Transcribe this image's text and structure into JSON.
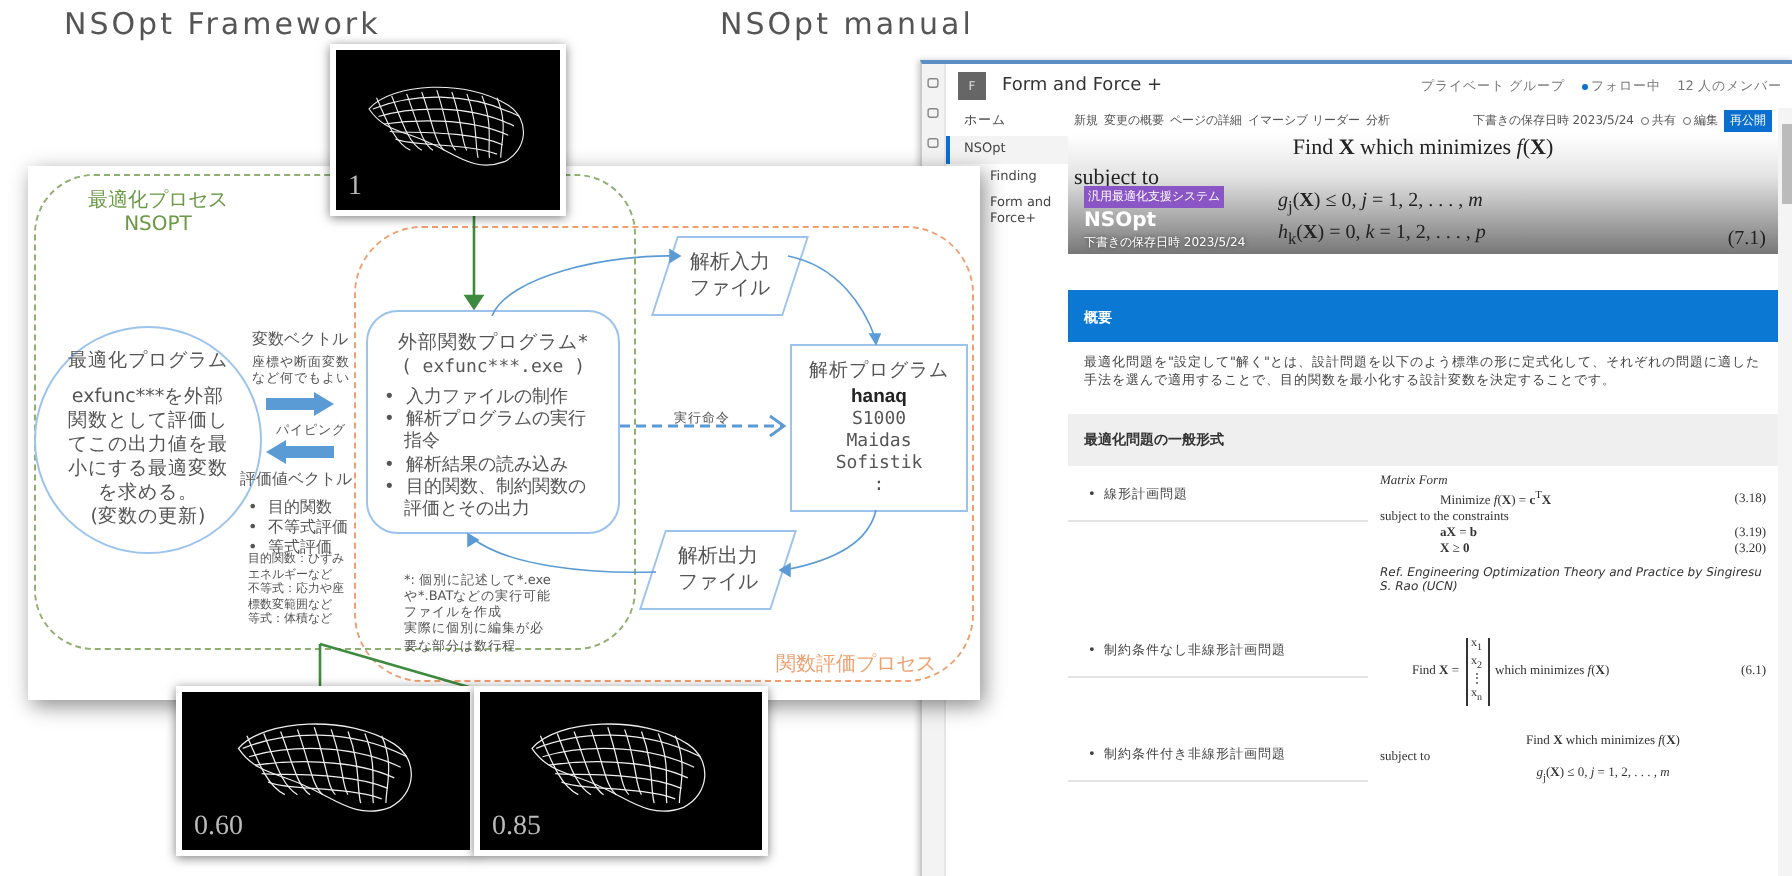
{
  "titles": [
    "NSOpt Framework",
    "NSOpt manual"
  ],
  "diagram": {
    "optimization_process": {
      "title": "最適化プロセス",
      "subtitle": "NSOPT"
    },
    "optimizer": {
      "title": "最適化プログラム",
      "text": "exfunc***を外部関数として評価してこの出力値を最小にする最適変数を求める。",
      "note": "(変数の更新)"
    },
    "variables": {
      "label": "変数ベクトル",
      "note": "座標や断面変数など何でもよい"
    },
    "piping": "パイピング",
    "evaluation": {
      "label": "評価値ベクトル",
      "items": [
        "•  目的関数",
        "•  不等式評価",
        "•  等式評価"
      ],
      "notes": [
        "目的関数：ひずみエネルギーなど",
        "不等式：応力や座標数変範囲など",
        "等式：体積など"
      ]
    },
    "function_process": "関数評価プロセス",
    "external_program": {
      "title": "外部関数プログラム*",
      "subtitle": "( exfunc***.exe )",
      "items": [
        "•  入力ファイルの制作",
        "•  解析プログラムの実行指令",
        "•  解析結果の読み込み",
        "•  目的関数、制約関数の評価とその出力"
      ],
      "notes": [
        "*: 個別に記述して*.exeや*.BATなどの実行可能ファイルを作成",
        "実際に個別に編集が必要な部分は数行程"
      ]
    },
    "input_file": [
      "解析入力",
      "ファイル"
    ],
    "output_file": [
      "解析出力",
      "ファイル"
    ],
    "analysis": {
      "title": "解析プログラム",
      "tools": [
        "hanaq",
        "S1000",
        "Maidas",
        "Sofistik",
        ":"
      ]
    },
    "command": "実行命令",
    "renders": [
      {
        "label": "1"
      },
      {
        "label": "0.60"
      },
      {
        "label": "0.85"
      }
    ]
  },
  "manual": {
    "site_logo": "F",
    "site_title": "Form and Force +",
    "group": "プライベート グループ",
    "follow": "フォロー中",
    "members": "12 人のメンバー",
    "nav": [
      {
        "label": "ホーム",
        "selected": false
      },
      {
        "label": "NSOpt",
        "selected": true
      },
      {
        "label": "Finding",
        "selected": false
      },
      {
        "label": "Form and Force+",
        "selected": false
      }
    ],
    "toolbar": [
      "新規",
      "変更の概要",
      "ページの詳細",
      "イマーシブ リーダー",
      "分析"
    ],
    "draft": "下書きの保存日時 2023/5/24",
    "share": "共有",
    "edit": "編集",
    "republish": "再公開",
    "banner": {
      "tag": "汎用最適化支援システム",
      "title": "NSOpt",
      "date": "下書きの保存日時 2023/5/24"
    },
    "equation": {
      "line": "Find **X** which minimizes *f*(**X**)",
      "subject": "subject to",
      "constraints": [
        "*g*$_{j}$(**X**) ≤ 0,    *j* = 1, 2, . . . , *m*",
        "*h*$_{k}$(**X**) = 0,    *k* = 1, 2, . . . , *p*"
      ],
      "number": "(7.1)"
    },
    "overview_heading": "概要",
    "overview_text": "最適化問題を\"設定して\"解く\"とは、設計問題を以下のよう標準の形に定式化して、それぞれの問題に適した手法を選んで適用することで、目的関数を最小化する設計変数を決定することです。",
    "general_heading": "最適化問題の一般形式",
    "rows": [
      {
        "label": "•  線形計画問題",
        "formulas": [
          {
            "kind": "caption",
            "text": "Matrix Form"
          },
          {
            "kind": "eq",
            "text": "Minimize *f*(**X**) = **c**$^{T}$**X**",
            "number": "(3.18)"
          },
          {
            "kind": "plain",
            "text": "subject to the constraints"
          },
          {
            "kind": "eq",
            "text": "**aX** = **b**",
            "number": "(3.19)"
          },
          {
            "kind": "eq",
            "text": "**X** ≥ **0**",
            "number": "(3.20)"
          },
          {
            "kind": "ref",
            "text": "Ref. Engineering Optimization Theory and Practice by Singiresu S. Rao (UCN)"
          }
        ]
      },
      {
        "label": "•  制約条件なし非線形計画問題",
        "formulas": [
          {
            "kind": "matrix",
            "text": "Find **X** =",
            "entries": [
              "x$_{1}$",
              "x$_{2}$",
              "⋮",
              "x$_{n}$"
            ],
            "after": "which minimizes *f*(**X**)",
            "number": "(6.1)"
          }
        ]
      },
      {
        "label": "•  制約条件付き非線形計画問題",
        "formulas": [
          {
            "kind": "eq",
            "text": "Find **X** which minimizes *f*(**X**)"
          },
          {
            "kind": "plain",
            "text": "subject to"
          },
          {
            "kind": "eq",
            "text": "*g*$_{j}$(**X**) ≤ 0,   *j* = 1, 2, . . . , *m*"
          }
        ]
      }
    ]
  }
}
